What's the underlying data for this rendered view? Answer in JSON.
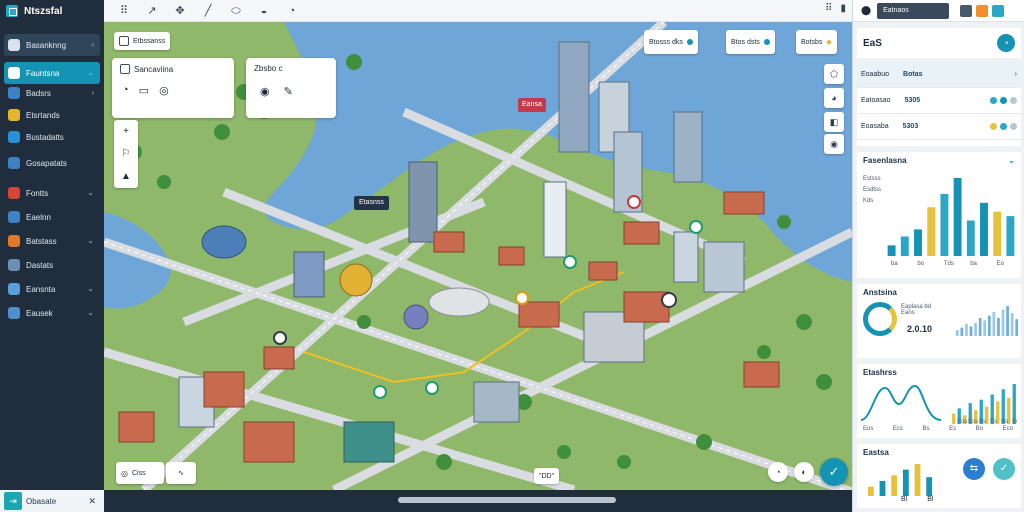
{
  "app": {
    "title": "Ntszsfal"
  },
  "sidebar": {
    "items": [
      {
        "label": "Basanknng",
        "icon": "folder-icon",
        "color": "#d8e2ec",
        "variant": "primary",
        "chevron": "‹"
      },
      {
        "label": "Fauntsna",
        "icon": "compass-icon",
        "color": "#ffffff",
        "variant": "active",
        "chevron": "⌄"
      },
      {
        "label": "Badsrs",
        "icon": "globe-icon",
        "color": "#3c82c4",
        "variant": "",
        "chevron": "›"
      },
      {
        "label": "Etsrtands",
        "icon": "shield-icon",
        "color": "#e3b52c",
        "variant": "",
        "chevron": ""
      },
      {
        "label": "Bustadatts",
        "icon": "gear-icon",
        "color": "#2a8fd6",
        "variant": "",
        "chevron": ""
      },
      {
        "label": "Gosapatats",
        "icon": "monitor-icon",
        "color": "#3c82c4",
        "variant": "",
        "chevron": ""
      },
      {
        "label": "Fontts",
        "icon": "alert-icon",
        "color": "#d84536",
        "variant": "",
        "chevron": "⌄"
      },
      {
        "label": "Eaelnn",
        "icon": "document-icon",
        "color": "#3c82c4",
        "variant": "",
        "chevron": ""
      },
      {
        "label": "Batstass",
        "icon": "warning-icon",
        "color": "#e07a2a",
        "variant": "",
        "chevron": "⌄"
      },
      {
        "label": "Dastats",
        "icon": "file-icon",
        "color": "#6b8fb5",
        "variant": "",
        "chevron": ""
      },
      {
        "label": "Eansnta",
        "icon": "plane-icon",
        "color": "#5a9fd8",
        "variant": "",
        "chevron": "⌄"
      },
      {
        "label": "Eausek",
        "icon": "chart-icon",
        "color": "#4f8fd0",
        "variant": "",
        "chevron": "⌄"
      }
    ],
    "footer_label": "Obasate",
    "footer_close": "✕"
  },
  "toolbar": {
    "buttons": [
      "⠿",
      "↗",
      "✥",
      "╱",
      "⬭",
      "◒",
      "◔"
    ],
    "right_icons": [
      "⠿",
      "▮"
    ]
  },
  "map": {
    "layer_chip": "Etbssanss",
    "panel_a": {
      "title": "Sancaviina",
      "icons": [
        "◔",
        "▭",
        "◎"
      ]
    },
    "panel_b": {
      "title": "Zbsbo c",
      "icons": [
        "◉",
        "✎"
      ]
    },
    "info_chips": [
      "Btosss dks",
      "Btos dsts",
      "Botsbs"
    ],
    "marker_label": "Etasnss",
    "building_tag": "Eansa",
    "bottom_chip_a": "Ciss",
    "bottom_center": "\"DD\"",
    "vtools": [
      "+",
      "⚐",
      "▲"
    ],
    "right_tools": [
      "⬠",
      "◕",
      "◧",
      "◉"
    ],
    "zoom_controls": [
      "◔",
      "◐"
    ],
    "fab": "✓",
    "water_color": "#6fa6d8",
    "land_color": "#8fb86a"
  },
  "rightpanel": {
    "search_label": "Eatnaos",
    "card_title": "EaS",
    "rows": [
      {
        "label": "Eoaabuo",
        "value": "Botas"
      },
      {
        "label": "Eatoasao",
        "value": "5305"
      },
      {
        "label": "Eoasaba",
        "value": "5303"
      }
    ],
    "chart1": {
      "title": "Fasenlasna",
      "lines": [
        "Estsss",
        "Esdtss",
        "Kds"
      ],
      "x_labels": [
        "ba",
        "bo",
        "Tds",
        "ba",
        "Eo"
      ]
    },
    "chart2": {
      "title": "Anstsina",
      "lines": [
        "Eaplasa bd",
        "Eans"
      ],
      "big_value": "2.0.10"
    },
    "chart3": {
      "title": "Etashrss",
      "x_labels": [
        "Eos",
        "Ecs",
        "Bs",
        "Es",
        "Bo",
        "Eco"
      ]
    },
    "chart4": {
      "title": "Eastsa",
      "footer": [
        "Bl",
        "Bl"
      ]
    }
  },
  "chart_data": [
    {
      "type": "bar",
      "title": "Fasenlasna",
      "categories": [
        "ba",
        "bo",
        "Tds",
        "ba",
        "Eo"
      ],
      "series": [
        {
          "values": [
            12,
            22,
            30,
            55,
            70,
            88,
            40,
            60,
            50,
            45
          ]
        }
      ]
    },
    {
      "type": "bar",
      "title": "Anstsina",
      "series": [
        {
          "values": [
            10,
            14,
            20,
            16,
            22,
            30,
            26,
            34,
            40,
            30,
            44,
            50,
            38,
            28
          ]
        }
      ]
    },
    {
      "type": "bar",
      "title": "Etashrss",
      "categories": [
        "Eos",
        "Ecs",
        "Bs",
        "Es",
        "Bo",
        "Eco"
      ],
      "series": [
        {
          "values": [
            12,
            18,
            10,
            24,
            16,
            28,
            20,
            34,
            26,
            40,
            30,
            46
          ]
        }
      ]
    },
    {
      "type": "bar",
      "title": "Eastsa",
      "series": [
        {
          "values": [
            10,
            16,
            22,
            28,
            34,
            20
          ]
        }
      ]
    }
  ]
}
